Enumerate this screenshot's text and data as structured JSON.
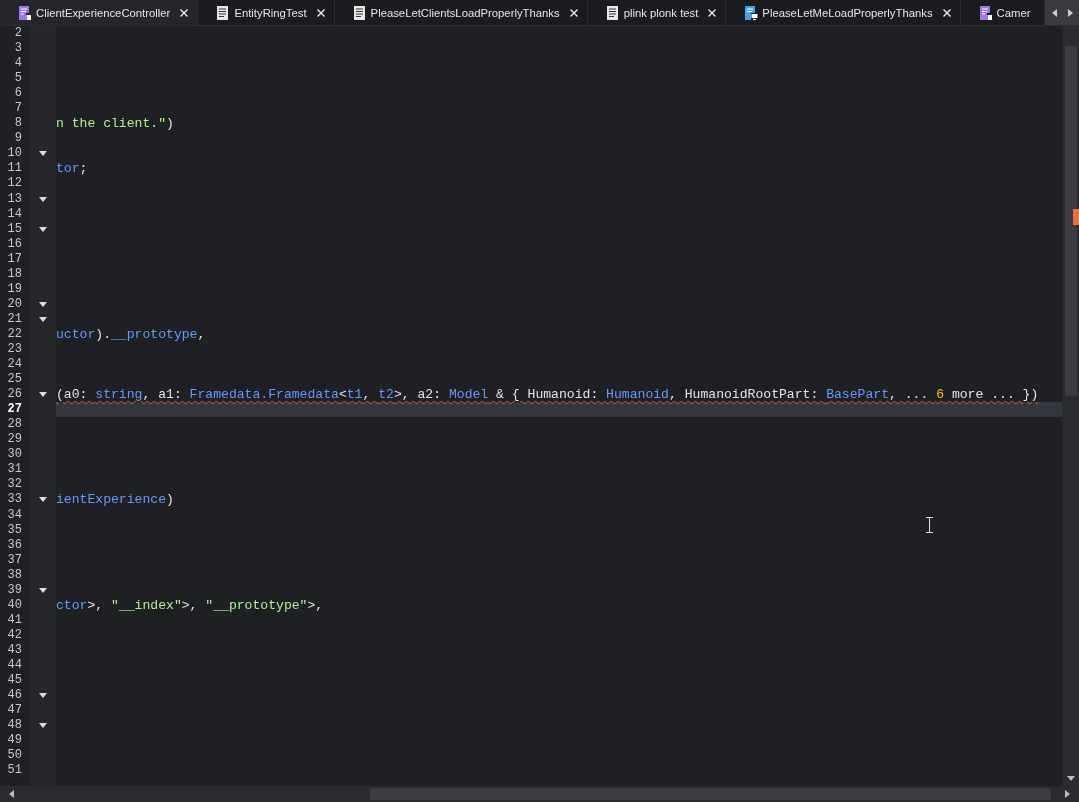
{
  "tabs": [
    {
      "label": "ClientExperienceController",
      "selected": true,
      "kind": "module",
      "closable": true
    },
    {
      "label": "EntityRingTest",
      "selected": false,
      "kind": "script",
      "closable": true
    },
    {
      "label": "PleaseLetClientsLoadProperlyThanks",
      "selected": false,
      "kind": "script",
      "closable": true
    },
    {
      "label": "plink plonk test",
      "selected": false,
      "kind": "script",
      "closable": true
    },
    {
      "label": "PleaseLetMeLoadProperlyThanks",
      "selected": false,
      "kind": "local",
      "closable": true
    },
    {
      "label": "Camer",
      "selected": false,
      "kind": "module",
      "closable": false
    }
  ],
  "editor": {
    "lines": [
      {
        "number": "2",
        "foldable": false,
        "current": false
      },
      {
        "number": "3",
        "foldable": false,
        "current": false
      },
      {
        "number": "4",
        "foldable": false,
        "current": false
      },
      {
        "number": "5",
        "foldable": false,
        "current": false
      },
      {
        "number": "6",
        "foldable": false,
        "current": false
      },
      {
        "number": "7",
        "foldable": false,
        "current": false
      },
      {
        "number": "8",
        "foldable": false,
        "current": false,
        "tokens": [
          {
            "text": "n the client.\"",
            "kind": "string"
          },
          {
            "text": ")",
            "kind": "plain"
          }
        ]
      },
      {
        "number": "9",
        "foldable": false,
        "current": false
      },
      {
        "number": "10",
        "foldable": true,
        "current": false
      },
      {
        "number": "11",
        "foldable": false,
        "current": false,
        "tokens": [
          {
            "text": "tor",
            "kind": "type"
          },
          {
            "text": ";",
            "kind": "plain"
          }
        ]
      },
      {
        "number": "12",
        "foldable": false,
        "current": false
      },
      {
        "number": "13",
        "foldable": true,
        "current": false
      },
      {
        "number": "14",
        "foldable": false,
        "current": false
      },
      {
        "number": "15",
        "foldable": true,
        "current": false
      },
      {
        "number": "16",
        "foldable": false,
        "current": false
      },
      {
        "number": "17",
        "foldable": false,
        "current": false
      },
      {
        "number": "18",
        "foldable": false,
        "current": false
      },
      {
        "number": "19",
        "foldable": false,
        "current": false
      },
      {
        "number": "20",
        "foldable": true,
        "current": false
      },
      {
        "number": "21",
        "foldable": true,
        "current": false
      },
      {
        "number": "22",
        "foldable": false,
        "current": false,
        "tokens": [
          {
            "text": "uctor",
            "kind": "type"
          },
          {
            "text": ").",
            "kind": "plain"
          },
          {
            "text": "__prototype",
            "kind": "type"
          },
          {
            "text": ",",
            "kind": "plain"
          }
        ]
      },
      {
        "number": "23",
        "foldable": false,
        "current": false
      },
      {
        "number": "24",
        "foldable": false,
        "current": false
      },
      {
        "number": "25",
        "foldable": false,
        "current": false
      },
      {
        "number": "26",
        "foldable": true,
        "current": false,
        "error": true,
        "tokens": [
          {
            "text": "(a0: ",
            "kind": "plain"
          },
          {
            "text": "string",
            "kind": "type"
          },
          {
            "text": ", a1: ",
            "kind": "plain"
          },
          {
            "text": "Framedata.Framedata",
            "kind": "type"
          },
          {
            "text": "<",
            "kind": "plain"
          },
          {
            "text": "t1",
            "kind": "type"
          },
          {
            "text": ", ",
            "kind": "plain"
          },
          {
            "text": "t2",
            "kind": "type"
          },
          {
            "text": ">, a2: ",
            "kind": "plain"
          },
          {
            "text": "Model",
            "kind": "type"
          },
          {
            "text": " & { Humanoid: ",
            "kind": "plain"
          },
          {
            "text": "Humanoid",
            "kind": "type"
          },
          {
            "text": ", HumanoidRootPart: ",
            "kind": "plain"
          },
          {
            "text": "BasePart",
            "kind": "type"
          },
          {
            "text": ", ... ",
            "kind": "plain"
          },
          {
            "text": "6",
            "kind": "number"
          },
          {
            "text": " more ... })",
            "kind": "plain"
          }
        ]
      },
      {
        "number": "27",
        "foldable": false,
        "current": true
      },
      {
        "number": "28",
        "foldable": false,
        "current": false
      },
      {
        "number": "29",
        "foldable": false,
        "current": false
      },
      {
        "number": "30",
        "foldable": false,
        "current": false
      },
      {
        "number": "31",
        "foldable": false,
        "current": false
      },
      {
        "number": "32",
        "foldable": false,
        "current": false
      },
      {
        "number": "33",
        "foldable": true,
        "current": false,
        "tokens": [
          {
            "text": "ientExperience",
            "kind": "type"
          },
          {
            "text": ")",
            "kind": "plain"
          }
        ]
      },
      {
        "number": "34",
        "foldable": false,
        "current": false
      },
      {
        "number": "35",
        "foldable": false,
        "current": false
      },
      {
        "number": "36",
        "foldable": false,
        "current": false
      },
      {
        "number": "37",
        "foldable": false,
        "current": false
      },
      {
        "number": "38",
        "foldable": false,
        "current": false
      },
      {
        "number": "39",
        "foldable": true,
        "current": false
      },
      {
        "number": "40",
        "foldable": false,
        "current": false,
        "tokens": [
          {
            "text": "ctor",
            "kind": "type"
          },
          {
            "text": ">, ",
            "kind": "plain"
          },
          {
            "text": "\"__index\"",
            "kind": "string"
          },
          {
            "text": ">, ",
            "kind": "plain"
          },
          {
            "text": "\"__prototype\"",
            "kind": "string"
          },
          {
            "text": ">,",
            "kind": "plain"
          }
        ]
      },
      {
        "number": "41",
        "foldable": false,
        "current": false
      },
      {
        "number": "42",
        "foldable": false,
        "current": false
      },
      {
        "number": "43",
        "foldable": false,
        "current": false
      },
      {
        "number": "44",
        "foldable": false,
        "current": false
      },
      {
        "number": "45",
        "foldable": false,
        "current": false
      },
      {
        "number": "46",
        "foldable": true,
        "current": false
      },
      {
        "number": "47",
        "foldable": false,
        "current": false
      },
      {
        "number": "48",
        "foldable": true,
        "current": false
      },
      {
        "number": "49",
        "foldable": false,
        "current": false
      },
      {
        "number": "50",
        "foldable": false,
        "current": false
      },
      {
        "number": "51",
        "foldable": false,
        "current": false
      }
    ]
  }
}
